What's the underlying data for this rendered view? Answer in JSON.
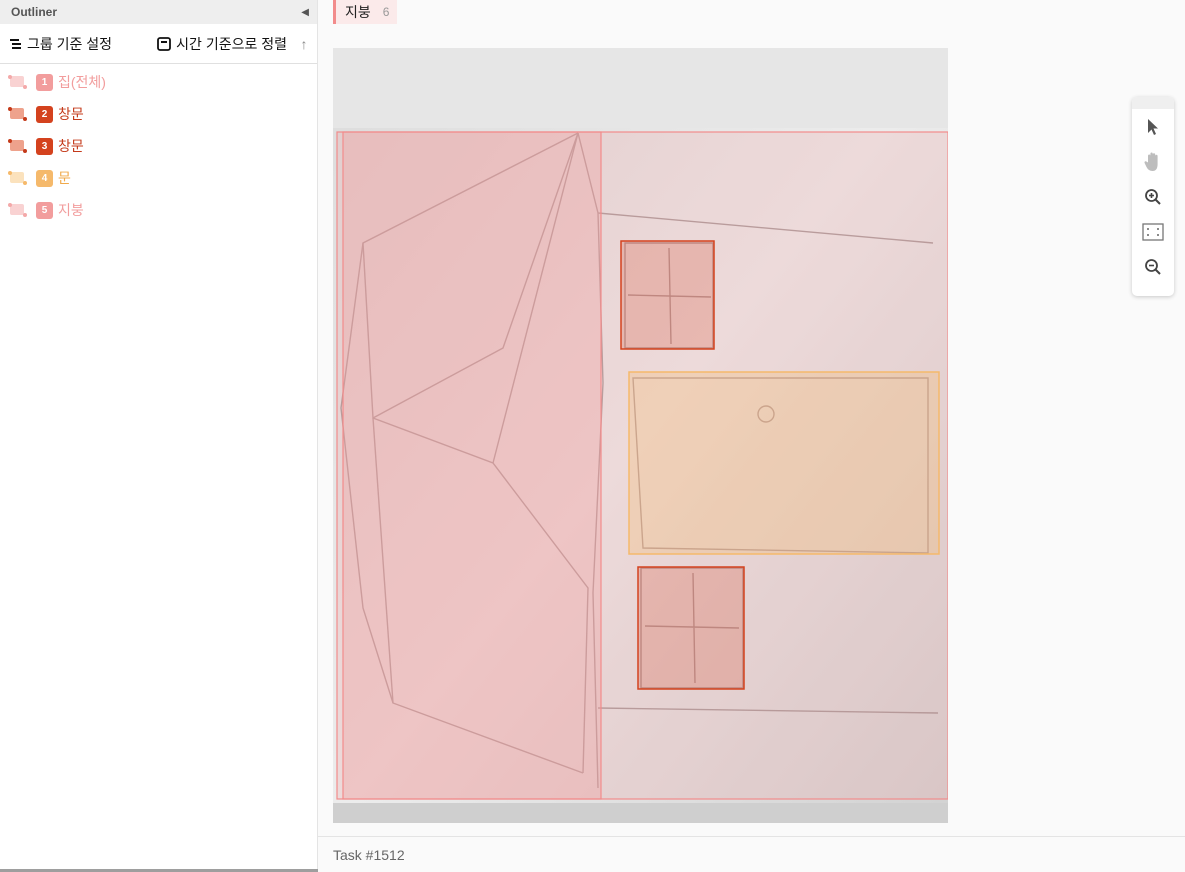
{
  "outliner": {
    "title": "Outliner",
    "group_by_label": "그룹 기준 설정",
    "sort_label": "시간 기준으로 정렬",
    "items": [
      {
        "index": "1",
        "label": "집(전체)",
        "color": "#f29d9d",
        "icon": "region-icon"
      },
      {
        "index": "2",
        "label": "창문",
        "color": "#d4421e",
        "icon": "region-icon"
      },
      {
        "index": "3",
        "label": "창문",
        "color": "#d4421e",
        "icon": "region-icon"
      },
      {
        "index": "4",
        "label": "문",
        "color": "#f5b96b",
        "icon": "region-icon"
      },
      {
        "index": "5",
        "label": "지붕",
        "color": "#f29d9d",
        "icon": "region-icon"
      }
    ]
  },
  "active_label": {
    "name": "지붕",
    "count": "6",
    "color": "#f28b8b"
  },
  "canvas": {
    "regions": [
      {
        "label": "집(전체)",
        "color": "#f29d9d"
      },
      {
        "label": "창문",
        "color": "#d4421e"
      },
      {
        "label": "창문",
        "color": "#d4421e"
      },
      {
        "label": "문",
        "color": "#f5b96b"
      },
      {
        "label": "지붕",
        "color": "#f29d9d"
      }
    ]
  },
  "tools": [
    "pointer-icon",
    "pan-hand-icon",
    "zoom-in-icon",
    "fit-screen-icon",
    "zoom-out-icon"
  ],
  "footer": {
    "task": "Task #1512"
  }
}
